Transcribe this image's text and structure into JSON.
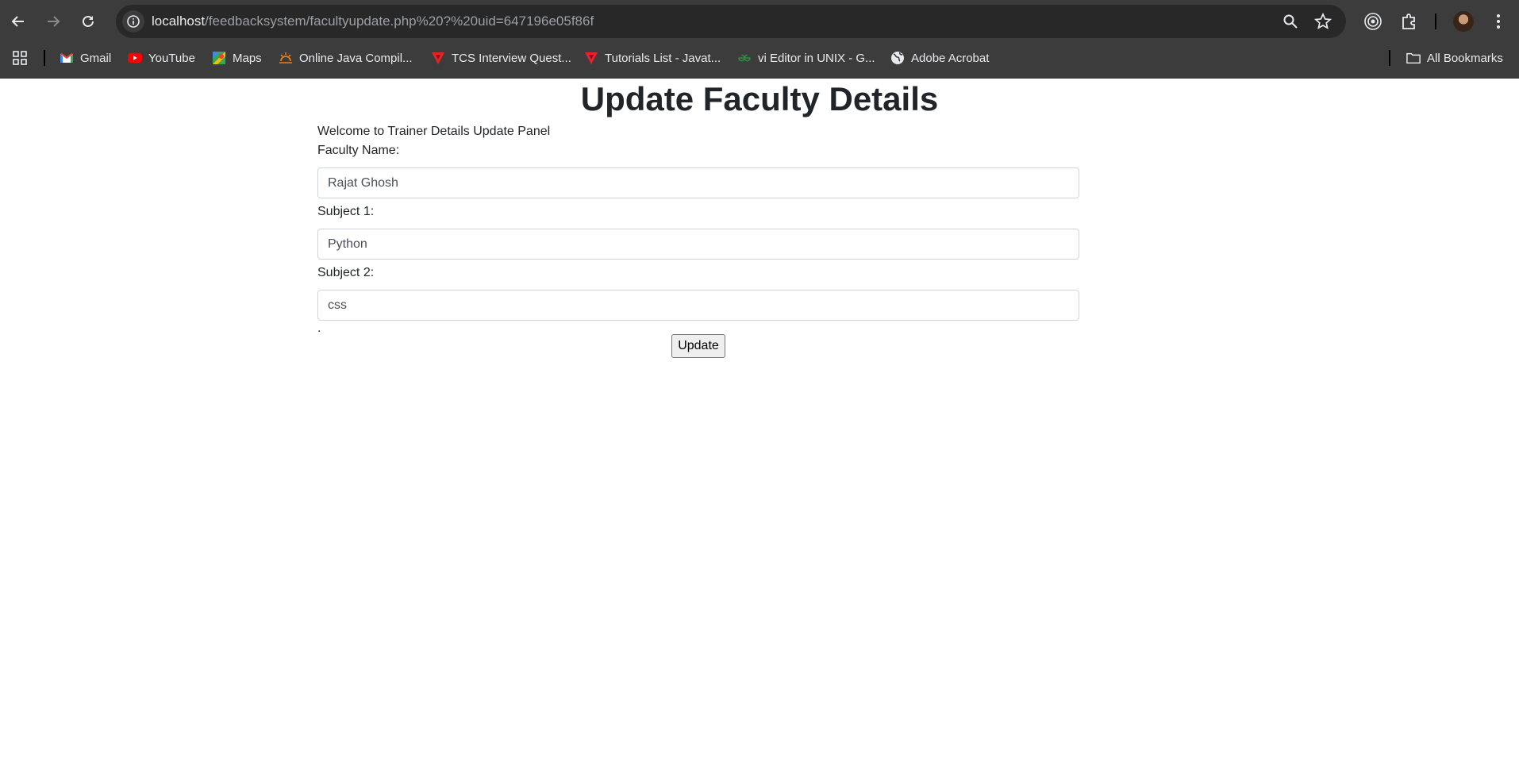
{
  "browser": {
    "url_host": "localhost",
    "url_path": "/feedbacksystem/facultyupdate.php%20?%20uid=647196e05f86f",
    "icons": {
      "back": "arrow-left-icon",
      "forward": "arrow-right-icon",
      "reload": "reload-icon",
      "site_info": "info-icon",
      "zoom": "zoom-icon",
      "bookmark": "star-icon",
      "extensions": "puzzle-icon",
      "menu": "more-vert-icon"
    },
    "bookmarks": [
      {
        "label": "Gmail",
        "icon": "gmail-icon"
      },
      {
        "label": "YouTube",
        "icon": "youtube-icon"
      },
      {
        "label": "Maps",
        "icon": "maps-icon"
      },
      {
        "label": "Online Java Compil...",
        "icon": "sunrise-icon"
      },
      {
        "label": "TCS Interview Quest...",
        "icon": "tcs-icon"
      },
      {
        "label": "Tutorials List - Javat...",
        "icon": "javatpoint-icon"
      },
      {
        "label": "vi Editor in UNIX - G...",
        "icon": "geeks-icon"
      },
      {
        "label": "Adobe Acrobat",
        "icon": "globe-icon"
      }
    ],
    "all_bookmarks": "All Bookmarks"
  },
  "page": {
    "title": "Update Faculty Details",
    "welcome": "Welcome to Trainer Details Update Panel",
    "faculty_name_label": "Faculty Name:",
    "faculty_name_value": "Rajat Ghosh",
    "subject1_label": "Subject 1:",
    "subject1_value": "Python",
    "subject2_label": "Subject 2:",
    "subject2_value": "css",
    "stray_text": ".",
    "update_button": "Update"
  }
}
